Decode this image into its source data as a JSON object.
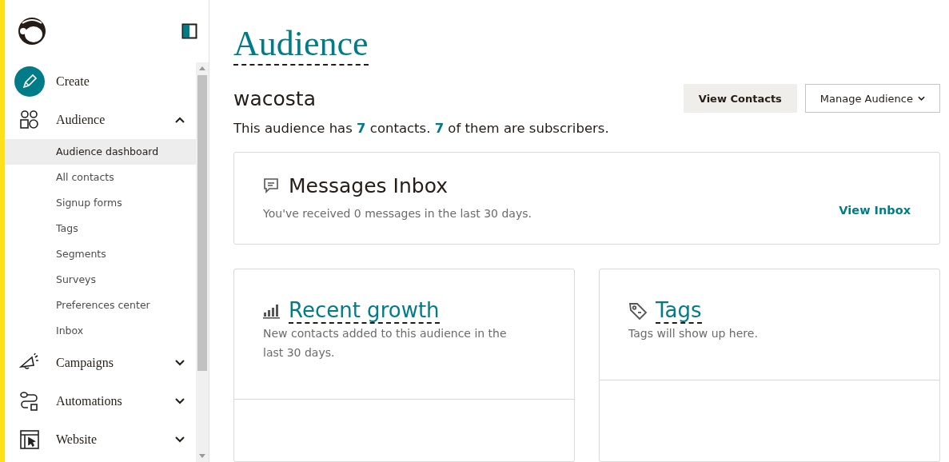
{
  "sidebar": {
    "items": [
      {
        "kind": "create",
        "label": "Create"
      },
      {
        "kind": "audience",
        "label": "Audience",
        "expanded": true,
        "children": [
          {
            "label": "Audience dashboard",
            "selected": true
          },
          {
            "label": "All contacts",
            "selected": false
          },
          {
            "label": "Signup forms",
            "selected": false
          },
          {
            "label": "Tags",
            "selected": false
          },
          {
            "label": "Segments",
            "selected": false
          },
          {
            "label": "Surveys",
            "selected": false
          },
          {
            "label": "Preferences center",
            "selected": false
          },
          {
            "label": "Inbox",
            "selected": false
          }
        ]
      },
      {
        "kind": "campaigns",
        "label": "Campaigns",
        "expanded": false
      },
      {
        "kind": "automations",
        "label": "Automations",
        "expanded": false
      },
      {
        "kind": "website",
        "label": "Website",
        "expanded": false
      }
    ]
  },
  "page": {
    "title": "Audience",
    "audience_name": "wacosta",
    "view_contacts": "View Contacts",
    "manage_audience": "Manage Audience",
    "summary": "This audience has **7** contacts. **7** of them are subscribers."
  },
  "inbox_card": {
    "title": "Messages Inbox",
    "text": "You've received 0 messages in the last 30 days.",
    "link": "View Inbox"
  },
  "cards": [
    {
      "kind": "growth",
      "title": "Recent growth",
      "text": "New contacts added to this audience in the last 30 days."
    },
    {
      "kind": "tags",
      "title": "Tags",
      "text": "Tags will show up here."
    }
  ]
}
